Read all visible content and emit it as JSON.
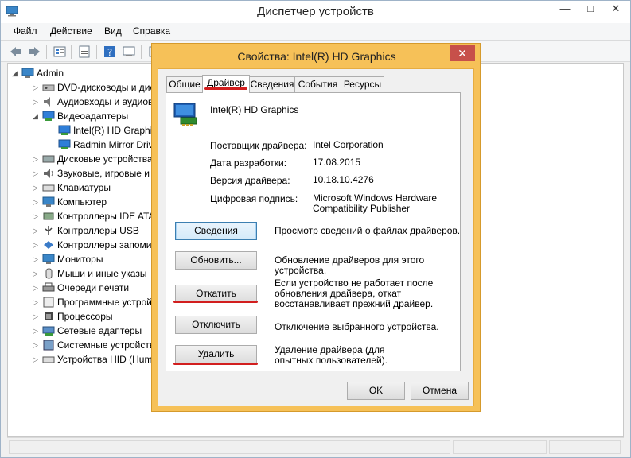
{
  "window": {
    "title": "Диспетчер устройств",
    "controls": {
      "minimize": "—",
      "maximize": "□",
      "close": "✕"
    }
  },
  "menu": [
    "Файл",
    "Действие",
    "Вид",
    "Справка"
  ],
  "toolbar_icons": [
    "back-arrow-icon",
    "forward-arrow-icon",
    "properties-icon",
    "help-icon",
    "device-icon"
  ],
  "tree": {
    "root": "Admin",
    "items": [
      {
        "label": "DVD-дисководы и дис",
        "icon": "dvd-drive-icon",
        "expanded": false
      },
      {
        "label": "Аудиовходы и аудиов",
        "icon": "audio-icon",
        "expanded": false
      },
      {
        "label": "Видеоадаптеры",
        "icon": "display-adapter-icon",
        "expanded": true
      },
      {
        "label": "Intel(R) HD Graphic",
        "icon": "display-adapter-icon",
        "child": true
      },
      {
        "label": "Radmin Mirror Drive",
        "icon": "display-adapter-icon",
        "child": true
      },
      {
        "label": "Дисковые устройства",
        "icon": "disk-icon",
        "expanded": false
      },
      {
        "label": "Звуковые, игровые и",
        "icon": "sound-icon",
        "expanded": false
      },
      {
        "label": "Клавиатуры",
        "icon": "keyboard-icon",
        "expanded": false
      },
      {
        "label": "Компьютер",
        "icon": "computer-icon",
        "expanded": false
      },
      {
        "label": "Контроллеры IDE ATA",
        "icon": "ide-controller-icon",
        "expanded": false
      },
      {
        "label": "Контроллеры USB",
        "icon": "usb-icon",
        "expanded": false
      },
      {
        "label": "Контроллеры запоми",
        "icon": "storage-controller-icon",
        "expanded": false
      },
      {
        "label": "Мониторы",
        "icon": "monitor-icon",
        "expanded": false
      },
      {
        "label": "Мыши и иные указы",
        "icon": "mouse-icon",
        "expanded": false
      },
      {
        "label": "Очереди печати",
        "icon": "printer-icon",
        "expanded": false
      },
      {
        "label": "Программные устрой",
        "icon": "software-device-icon",
        "expanded": false
      },
      {
        "label": "Процессоры",
        "icon": "processor-icon",
        "expanded": false
      },
      {
        "label": "Сетевые адаптеры",
        "icon": "network-icon",
        "expanded": false
      },
      {
        "label": "Системные устройств",
        "icon": "system-device-icon",
        "expanded": false
      },
      {
        "label": "Устройства HID (Hum",
        "icon": "hid-icon",
        "expanded": false
      }
    ]
  },
  "dialog": {
    "title": "Свойства: Intel(R) HD Graphics",
    "close": "✕",
    "tabs": [
      "Общие",
      "Драйвер",
      "Сведения",
      "События",
      "Ресурсы"
    ],
    "active_tab": "Драйвер",
    "device_name": "Intel(R) HD Graphics",
    "props": [
      {
        "label": "Поставщик драйвера:",
        "value": "Intel Corporation"
      },
      {
        "label": "Дата разработки:",
        "value": "17.08.2015"
      },
      {
        "label": "Версия драйвера:",
        "value": "10.18.10.4276"
      },
      {
        "label": "Цифровая подпись:",
        "value": "Microsoft Windows Hardware Compatibility Publisher"
      }
    ],
    "actions": [
      {
        "button": "Сведения",
        "desc": "Просмотр сведений о файлах драйверов."
      },
      {
        "button": "Обновить...",
        "desc": "Обновление драйверов для этого устройства."
      },
      {
        "button": "Откатить",
        "desc": "Если устройство не работает после обновления драйвера, откат восстанавливает прежний драйвер."
      },
      {
        "button": "Отключить",
        "desc": "Отключение выбранного устройства."
      },
      {
        "button": "Удалить",
        "desc": "Удаление драйвера (для опытных пользователей)."
      }
    ],
    "ok": "OK",
    "cancel": "Отмена"
  },
  "colors": {
    "dialog_frame": "#f6c158",
    "close_button": "#c7504a",
    "highlight_mark": "#d21e1e"
  }
}
